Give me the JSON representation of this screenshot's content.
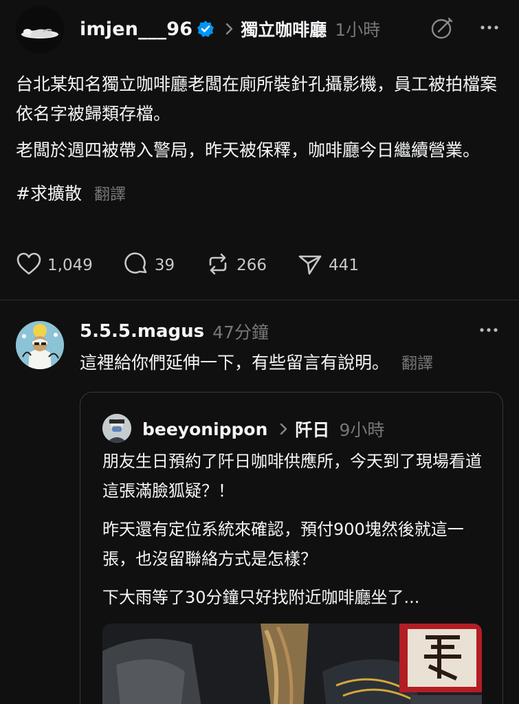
{
  "post": {
    "username": "imjen___96",
    "topic": "獨立咖啡廳",
    "time": "1小時",
    "paragraphs": [
      "台北某知名獨立咖啡廳老闆在廁所裝針孔攝影機，員工被拍檔案依名字被歸類存檔。",
      "老闆於週四被帶入警局，昨天被保釋，咖啡廳今日繼續營業。"
    ],
    "hashtag": "#求擴散",
    "translate": "翻譯",
    "likes": "1,049",
    "comments": "39",
    "reposts": "266",
    "shares": "441"
  },
  "reply": {
    "username": "5.5.5.magus",
    "time": "47分鐘",
    "text": "這裡給你們延伸一下，有些留言有說明。",
    "translate": "翻譯"
  },
  "quote": {
    "username": "beeyonippon",
    "topic": "阡日",
    "time": "9小時",
    "paragraphs": [
      "朋友生日預約了阡日咖啡供應所，今天到了現場看道這張滿臉狐疑？！",
      "昨天還有定位系統來確認，預付900塊然後就這一張，也沒留聯絡方式是怎樣？",
      "下大雨等了30分鐘只好找附近咖啡廳坐了..."
    ]
  },
  "colors": {
    "background": "#101010",
    "text": "#f3f5f7",
    "muted": "#777777",
    "verified": "#0095f6",
    "divider": "#2d2d2d"
  },
  "icons": [
    "verified-badge-icon",
    "chevron-right-icon",
    "compose-icon",
    "more-icon",
    "heart-icon",
    "comment-icon",
    "repost-icon",
    "share-icon"
  ]
}
